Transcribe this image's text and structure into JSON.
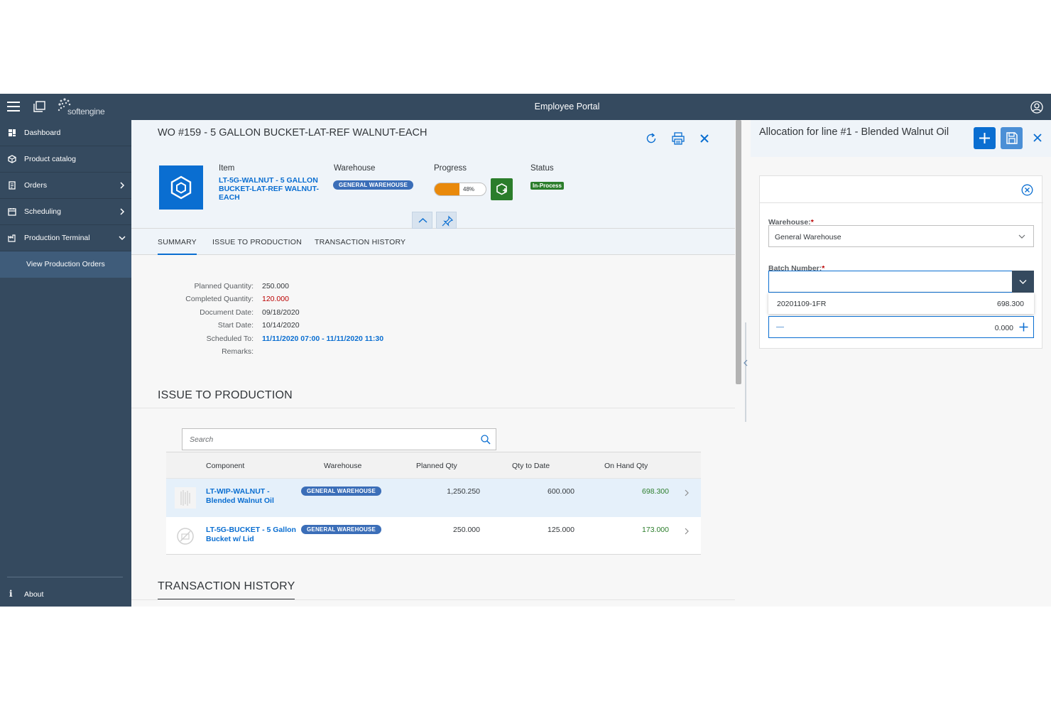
{
  "shell": {
    "title": "Employee Portal",
    "logo_text": "softengine"
  },
  "sidebar": {
    "items": [
      {
        "label": "Dashboard",
        "icon": "dashboard-icon"
      },
      {
        "label": "Product catalog",
        "icon": "catalog-icon"
      },
      {
        "label": "Orders",
        "icon": "orders-icon"
      },
      {
        "label": "Scheduling",
        "icon": "calendar-icon"
      },
      {
        "label": "Production Terminal",
        "icon": "factory-icon"
      }
    ],
    "sub_item": "View Production Orders",
    "about": "About"
  },
  "work_order": {
    "title": "WO #159 - 5 GALLON BUCKET-LAT-REF WALNUT-EACH",
    "item_label": "Item",
    "item_value": "LT-5G-WALNUT - 5 GALLON BUCKET-LAT-REF WALNUT-EACH",
    "warehouse_label": "Warehouse",
    "warehouse_value": "GENERAL WAREHOUSE",
    "progress_label": "Progress",
    "progress_value": "48%",
    "progress_fraction": 0.48,
    "status_label": "Status",
    "status_value": "In-Process"
  },
  "tabs": [
    "SUMMARY",
    "ISSUE TO PRODUCTION",
    "TRANSACTION HISTORY"
  ],
  "summary": {
    "planned_qty_label": "Planned Quantity:",
    "planned_qty": "250.000",
    "completed_qty_label": "Completed Quantity:",
    "completed_qty": "120.000",
    "document_date_label": "Document Date:",
    "document_date": "09/18/2020",
    "start_date_label": "Start Date:",
    "start_date": "10/14/2020",
    "scheduled_label": "Scheduled To:",
    "scheduled": "11/11/2020 07:00 - 11/11/2020 11:30",
    "remarks_label": "Remarks:"
  },
  "issue_section": {
    "title": "ISSUE TO PRODUCTION",
    "search_placeholder": "Search",
    "columns": [
      "Component",
      "Warehouse",
      "Planned Qty",
      "Qty to Date",
      "On Hand Qty"
    ],
    "rows": [
      {
        "component": "LT-WIP-WALNUT - Blended Walnut Oil",
        "warehouse": "GENERAL WAREHOUSE",
        "planned": "1,250.250",
        "to_date": "600.000",
        "on_hand": "698.300"
      },
      {
        "component": "LT-5G-BUCKET - 5 Gallon Bucket w/ Lid",
        "warehouse": "GENERAL WAREHOUSE",
        "planned": "250.000",
        "to_date": "125.000",
        "on_hand": "173.000"
      }
    ]
  },
  "history_section": {
    "title": "TRANSACTION HISTORY"
  },
  "allocation": {
    "title": "Allocation for line #1 - Blended Walnut Oil",
    "warehouse_label": "Warehouse:",
    "warehouse_value": "General Warehouse",
    "batch_label": "Batch Number:",
    "required_mark": "*",
    "batch_option": "20201109-1FR",
    "batch_option_qty": "698.300",
    "quantity": "0.000"
  }
}
